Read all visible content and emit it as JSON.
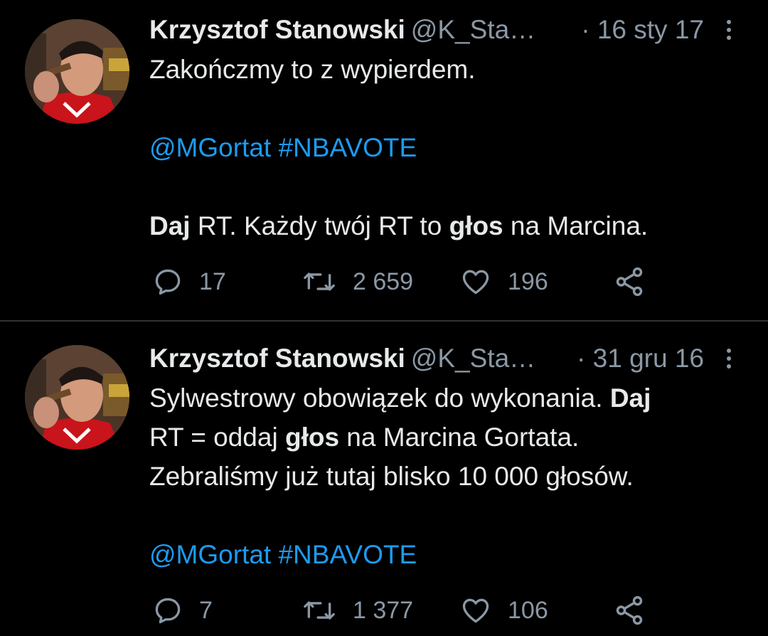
{
  "colors": {
    "background": "#000000",
    "text": "#e7e9ea",
    "muted": "#8b98a5",
    "link": "#1d9bf0",
    "divider": "#2f3336"
  },
  "icons": {
    "reply": "reply-icon",
    "retweet": "retweet-icon",
    "like": "heart-icon",
    "share": "share-icon",
    "more": "more-vertical-icon"
  },
  "tweets": [
    {
      "author_name": "Krzysztof Stanowski",
      "handle": "@K_Sta…",
      "date": "· 16 sty 17",
      "line1": "Zakończmy to z wypierdem.",
      "mention": "@MGortat",
      "hashtag": "#NBAVOTE",
      "line3_bold_a": "Daj",
      "line3_text_a": " RT. Każdy twój RT to ",
      "line3_bold_b": "głos",
      "line3_text_b": " na Marcina.",
      "replies": "17",
      "retweets": "2 659",
      "likes": "196"
    },
    {
      "author_name": "Krzysztof Stanowski",
      "handle": "@K_Sta…",
      "date": "· 31 gru 16",
      "line1_text": "Sylwestrowy obowiązek do wykonania. ",
      "line1_bold": "Daj",
      "line2_text_a": "RT = oddaj ",
      "line2_bold": "głos",
      "line2_text_b": " na Marcina Gortata.",
      "line3": "Zebraliśmy już tutaj blisko 10 000 głosów.",
      "mention": "@MGortat",
      "hashtag": "#NBAVOTE",
      "replies": "7",
      "retweets": "1 377",
      "likes": "106"
    }
  ]
}
